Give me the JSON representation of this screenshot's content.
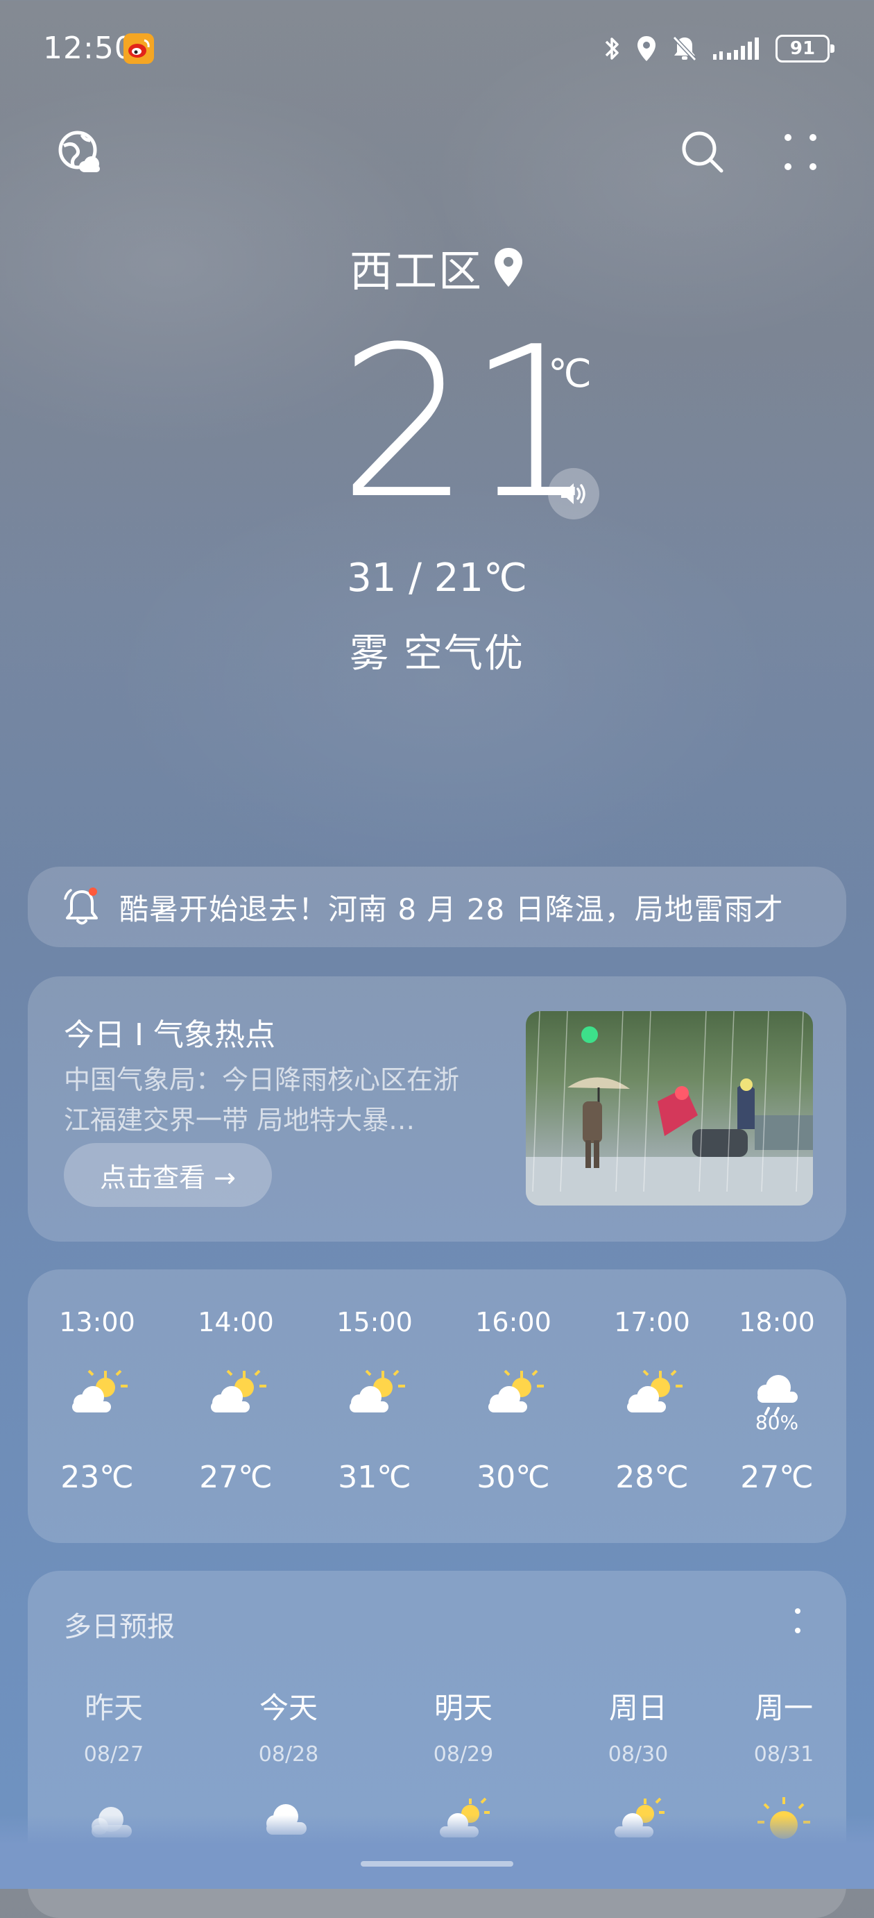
{
  "status_bar": {
    "time": "12:50",
    "battery": "91",
    "icons": [
      "weibo-icon",
      "bluetooth-icon",
      "location-icon",
      "mute-icon",
      "signal-icon",
      "battery-icon"
    ]
  },
  "header": {
    "location": "西工区",
    "icons": [
      "globe-weather-icon",
      "search-icon",
      "more-icon",
      "pin-icon"
    ]
  },
  "current": {
    "temperature": "21",
    "unit": "℃",
    "range": "31 / 21℃",
    "condition": "雾 空气优"
  },
  "alert": {
    "text": "酷暑开始退去！河南 8 月 28 日降温，局地雷雨才"
  },
  "hotspot": {
    "title": "今日 I 气象热点",
    "description": "中国气象局：今日降雨核心区在浙江福建交界一带 局地特大暴…",
    "button_label": "点击查看 →"
  },
  "hourly": [
    {
      "time": "13:00",
      "icon": "partly-sunny-icon",
      "temp": "23℃",
      "pop": ""
    },
    {
      "time": "14:00",
      "icon": "partly-sunny-icon",
      "temp": "27℃",
      "pop": ""
    },
    {
      "time": "15:00",
      "icon": "partly-sunny-icon",
      "temp": "31℃",
      "pop": ""
    },
    {
      "time": "16:00",
      "icon": "partly-sunny-icon",
      "temp": "30℃",
      "pop": ""
    },
    {
      "time": "17:00",
      "icon": "partly-sunny-icon",
      "temp": "28℃",
      "pop": ""
    },
    {
      "time": "18:00",
      "icon": "rain-cloud-icon",
      "temp": "27℃",
      "pop": "80%"
    }
  ],
  "daily": {
    "title": "多日预报",
    "days": [
      {
        "name": "昨天",
        "date": "08/27",
        "icon": "cloudy-icon"
      },
      {
        "name": "今天",
        "date": "08/28",
        "icon": "cloudy-icon"
      },
      {
        "name": "明天",
        "date": "08/29",
        "icon": "partly-sunny-icon"
      },
      {
        "name": "周日",
        "date": "08/30",
        "icon": "partly-sunny-icon"
      },
      {
        "name": "周一",
        "date": "08/31",
        "icon": "sunny-icon"
      }
    ]
  },
  "colors": {
    "accent_sun": "#ffd54a",
    "alert_dot": "#ff5a3c"
  }
}
